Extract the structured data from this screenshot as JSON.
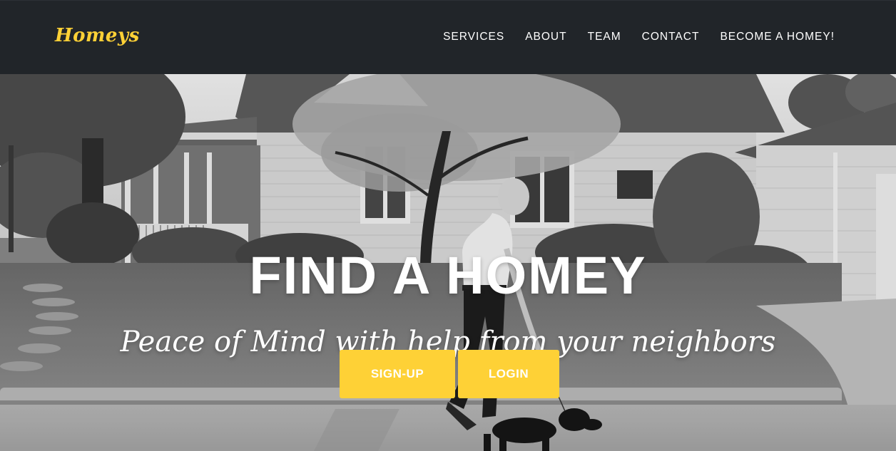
{
  "navbar": {
    "brand": "Homeys",
    "links": [
      "SERVICES",
      "ABOUT",
      "TEAM",
      "CONTACT",
      "BECOME A HOMEY!"
    ]
  },
  "hero": {
    "heading": "FIND A HOMEY",
    "subheading": "Peace of Mind with help from your neighbors",
    "buttons": {
      "signup": "SIGN-UP",
      "login": "LOGIN"
    }
  },
  "colors": {
    "navbar_bg": "#212529",
    "accent": "#fed136",
    "text": "#ffffff"
  }
}
